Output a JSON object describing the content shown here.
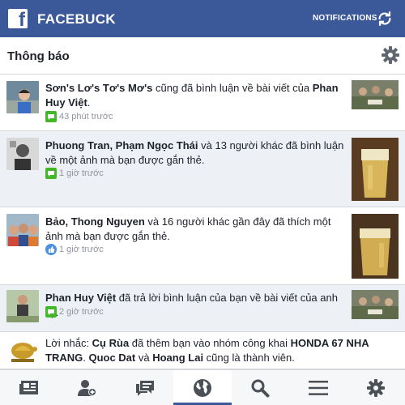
{
  "app": {
    "title": "FACEBUCK",
    "notifications_label": "NOTIFICATIONS",
    "brand_color": "#3b5998"
  },
  "header": {
    "title": "Thông báo"
  },
  "notifications": [
    {
      "unread": false,
      "segments": [
        {
          "text": "Sơn's Lơ's Tơ's Mơ's",
          "bold": true
        },
        {
          "text": " cũng đã bình luận về bài viết của ",
          "bold": false
        },
        {
          "text": "Phan Huy Việt",
          "bold": true
        },
        {
          "text": ".",
          "bold": false
        }
      ],
      "type": "comment",
      "time": "43 phút trước"
    },
    {
      "unread": true,
      "segments": [
        {
          "text": "Phuong Tran, Phạm Ngọc Thái",
          "bold": true
        },
        {
          "text": " và 13 người khác đã bình luận về một ảnh mà bạn được gắn thẻ.",
          "bold": false
        }
      ],
      "type": "comment",
      "time": "1 giờ trước"
    },
    {
      "unread": false,
      "segments": [
        {
          "text": "Bảo, Thong Nguyen",
          "bold": true
        },
        {
          "text": " và 16 người khác gần đây đã thích một ảnh mà bạn được gắn thẻ.",
          "bold": false
        }
      ],
      "type": "like",
      "time": "1 giờ trước"
    },
    {
      "unread": true,
      "segments": [
        {
          "text": "Phan Huy Việt",
          "bold": true
        },
        {
          "text": " đã trả lời bình luận của bạn về bài viết của anh ấy.",
          "bold": false
        }
      ],
      "type": "comment",
      "time": "2 giờ trước"
    },
    {
      "unread": false,
      "segments": [
        {
          "text": "Lời nhắc: ",
          "bold": false
        },
        {
          "text": "Cụ Rùa",
          "bold": true
        },
        {
          "text": " đã thêm bạn vào nhóm công khai ",
          "bold": false
        },
        {
          "text": "HONDA 67 NHA TRANG",
          "bold": true
        },
        {
          "text": ". ",
          "bold": false
        },
        {
          "text": "Quoc Dat",
          "bold": true
        },
        {
          "text": " và ",
          "bold": false
        },
        {
          "text": "Hoang Lai",
          "bold": true
        },
        {
          "text": " cũng là thành viên.",
          "bold": false
        }
      ],
      "type": "group",
      "time": ""
    }
  ],
  "bottom_nav": [
    {
      "icon": "news-feed-icon",
      "active": false
    },
    {
      "icon": "friend-requests-icon",
      "active": false
    },
    {
      "icon": "messages-icon",
      "active": false
    },
    {
      "icon": "globe-icon",
      "active": true
    },
    {
      "icon": "search-icon",
      "active": false
    },
    {
      "icon": "menu-icon",
      "active": false
    },
    {
      "icon": "settings-icon",
      "active": false
    }
  ]
}
